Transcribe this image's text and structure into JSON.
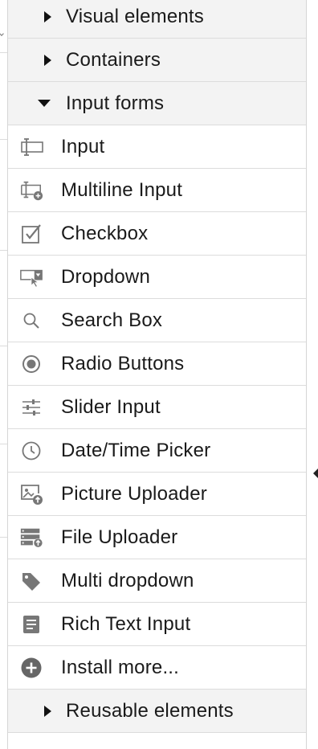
{
  "categories": {
    "visual": {
      "label": "Visual elements",
      "icon": "caret-right-icon"
    },
    "containers": {
      "label": "Containers",
      "icon": "caret-right-icon"
    },
    "input_forms": {
      "label": "Input forms",
      "icon": "caret-down-icon"
    },
    "reusable": {
      "label": "Reusable elements",
      "icon": "caret-right-icon"
    }
  },
  "items": [
    {
      "label": "Input",
      "icon": "input-icon"
    },
    {
      "label": "Multiline Input",
      "icon": "multiline-input-icon"
    },
    {
      "label": "Checkbox",
      "icon": "checkbox-icon"
    },
    {
      "label": "Dropdown",
      "icon": "dropdown-icon"
    },
    {
      "label": "Search Box",
      "icon": "search-icon"
    },
    {
      "label": "Radio Buttons",
      "icon": "radio-icon"
    },
    {
      "label": "Slider Input",
      "icon": "slider-icon"
    },
    {
      "label": "Date/Time Picker",
      "icon": "clock-icon"
    },
    {
      "label": "Picture Uploader",
      "icon": "picture-upload-icon"
    },
    {
      "label": "File Uploader",
      "icon": "file-upload-icon"
    },
    {
      "label": "Multi dropdown",
      "icon": "tag-icon"
    },
    {
      "label": "Rich Text Input",
      "icon": "document-icon"
    },
    {
      "label": "Install more...",
      "icon": "plus-circle-icon"
    }
  ],
  "colors": {
    "category_bg": "#f3f3f3",
    "divider": "#dcdcdc",
    "icon": "#777777",
    "text": "#1a1a1a"
  }
}
